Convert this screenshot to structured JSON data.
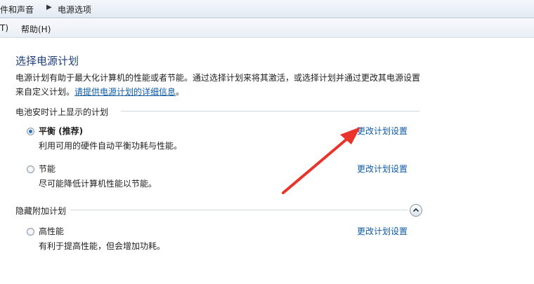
{
  "breadcrumb": {
    "item1": "件和声音",
    "item2": "电源选项"
  },
  "menu": {
    "item1": "T)",
    "item2": "帮助(H)"
  },
  "main": {
    "title": "选择电源计划",
    "description_line1": "电源计划有助于最大化计算机的性能或者节能。通过选择计划来将其激活，或选择计划并通过更改其电源设置",
    "description_line2_prefix": "来自定义计划。",
    "description_link": "请提供电源计划的详细信息",
    "description_suffix": "。"
  },
  "battery_group": {
    "title": "电池安时计上显示的计划",
    "plans": [
      {
        "name": "平衡 (推荐)",
        "description": "利用可用的硬件自动平衡功耗与性能。",
        "link": "更改计划设置",
        "selected": true
      },
      {
        "name": "节能",
        "description": "尽可能降低计算机性能以节能。",
        "link": "更改计划设置",
        "selected": false
      }
    ]
  },
  "hidden_group": {
    "title": "隐藏附加计划",
    "collapse_icon": "chevron-up-icon",
    "plans": [
      {
        "name": "高性能",
        "description": "有利于提高性能，但会增加功耗。",
        "link": "更改计划设置",
        "selected": false
      }
    ]
  },
  "annotation": {
    "arrow_color": "#e8342a"
  }
}
